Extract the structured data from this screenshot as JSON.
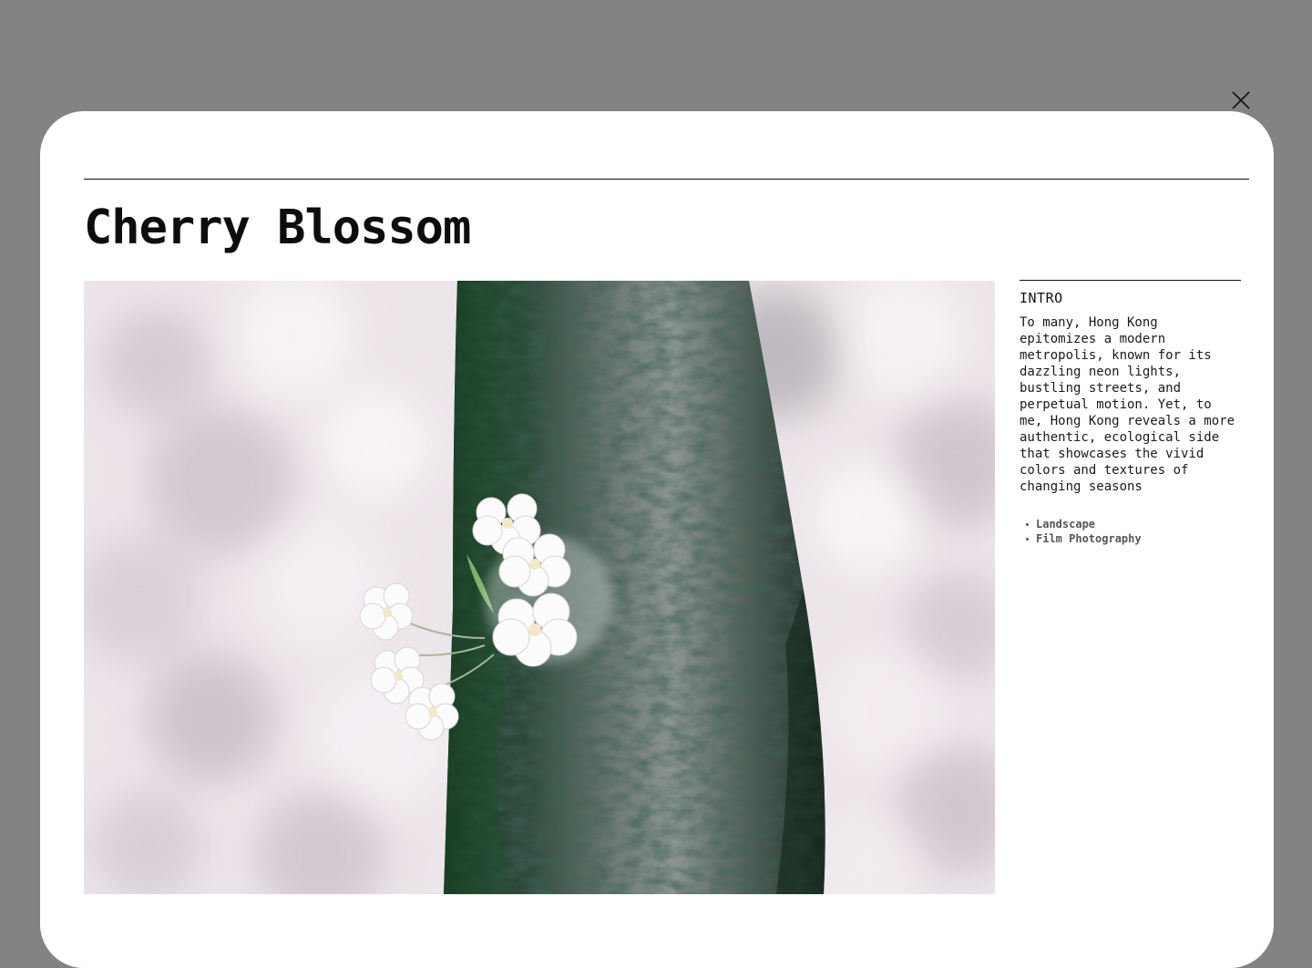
{
  "close": {
    "icon": "close-icon"
  },
  "project": {
    "title": "Cherry Blossom",
    "photo_description": "cherry blossom photo",
    "intro_heading": "INTRO",
    "intro_text": "To many, Hong Kong epitomizes a modern metropolis, known for its dazzling neon lights, bustling streets, and perpetual motion. Yet, to me, Hong Kong reveals a more authentic, ecological side that showcases the vivid colors and textures of changing seasons",
    "tags": [
      "Landscape",
      "Film Photography"
    ]
  },
  "colors": {
    "overlay": "#838383",
    "modal": "#ffffff",
    "text": "#111111",
    "tag_text": "#555555"
  }
}
